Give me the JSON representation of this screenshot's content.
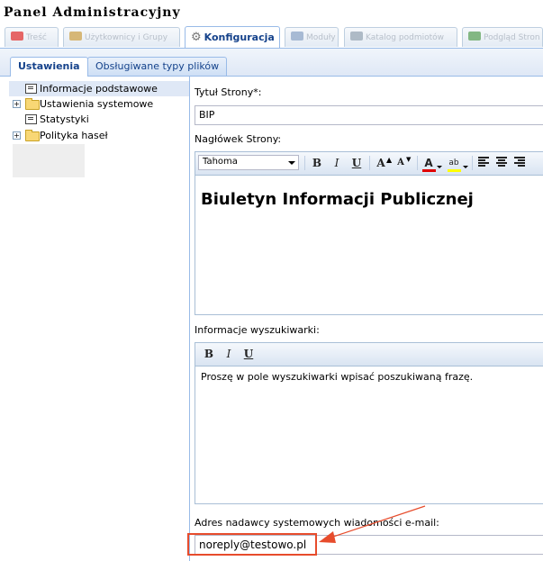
{
  "app": {
    "title": "Panel Administracyjny"
  },
  "top_tabs": [
    {
      "label": "Treść",
      "icon": "content-icon",
      "color": "#d33"
    },
    {
      "label": "Użytkownicy i Grupy",
      "icon": "users-icon",
      "color": "#c9a04a"
    },
    {
      "label": "Konfiguracja",
      "icon": "gear-icon",
      "active": true
    },
    {
      "label": "Moduły",
      "icon": "modules-icon",
      "color": "#8aa3c6"
    },
    {
      "label": "Katalog podmiotów",
      "icon": "catalog-icon",
      "color": "#93a3b3"
    },
    {
      "label": "Podgląd Stron",
      "icon": "preview-icon",
      "color": "#5aa05a"
    }
  ],
  "sub_tabs": [
    {
      "label": "Ustawienia",
      "active": true
    },
    {
      "label": "Obsługiwane typy plików"
    }
  ],
  "tree": [
    {
      "label": "Informacje podstawowe",
      "icon": "page-icon",
      "selected": true
    },
    {
      "label": "Ustawienia systemowe",
      "icon": "folder-icon",
      "expandable": true
    },
    {
      "label": "Statystyki",
      "icon": "page-icon"
    },
    {
      "label": "Polityka haseł",
      "icon": "folder-icon",
      "expandable": true
    }
  ],
  "form": {
    "site_title_label": "Tytuł Strony*:",
    "site_title_value": "BIP",
    "header_label": "Nagłówek Strony:",
    "header_editor": {
      "font": "Tahoma",
      "content": "Biuletyn Informacji Publicznej"
    },
    "search_label": "Informacje wyszukiwarki:",
    "search_editor": {
      "content": "Proszę w pole wyszukiwarki wpisać poszukiwaną frazę."
    },
    "email_label": "Adres nadawcy systemowych wiadomości e-mail:",
    "email_value": "noreply@testowo.pl"
  },
  "toolbar": {
    "bold": "B",
    "italic": "I",
    "underline": "U",
    "grow": "A",
    "shrink": "A",
    "fontcolor": "A",
    "highlight": "ab"
  },
  "colors": {
    "accent": "#15428b",
    "highlight_box": "#e74c2c",
    "font_color_bar": "#e00000",
    "highlight_bar": "#ffff00"
  }
}
